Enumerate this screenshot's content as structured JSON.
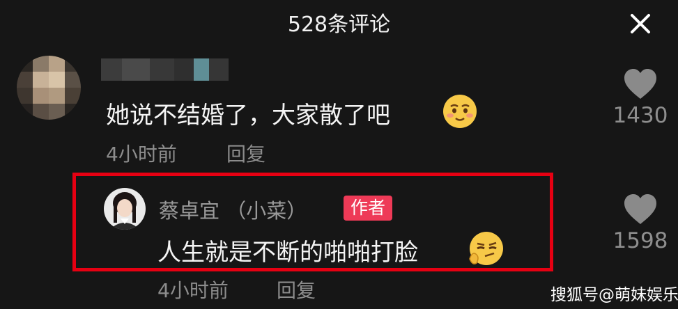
{
  "header": {
    "title": "528条评论",
    "close_icon": "close-icon"
  },
  "comments": [
    {
      "text": "她说不结婚了，大家散了吧",
      "emoji": "shy-smile-emoji",
      "time": "4小时前",
      "reply_label": "回复",
      "likes": "1430"
    }
  ],
  "reply": {
    "author": "蔡卓宜 （小菜）",
    "badge": "作者",
    "text": "人生就是不断的啪啪打脸",
    "emoji": "smirk-thinking-emoji",
    "time": "4小时前",
    "reply_label": "回复",
    "likes": "1598"
  },
  "watermark": "搜狐号@萌妹娱乐",
  "colors": {
    "highlight": "#e60012",
    "badge": "#ee3a57",
    "background": "#161616"
  }
}
